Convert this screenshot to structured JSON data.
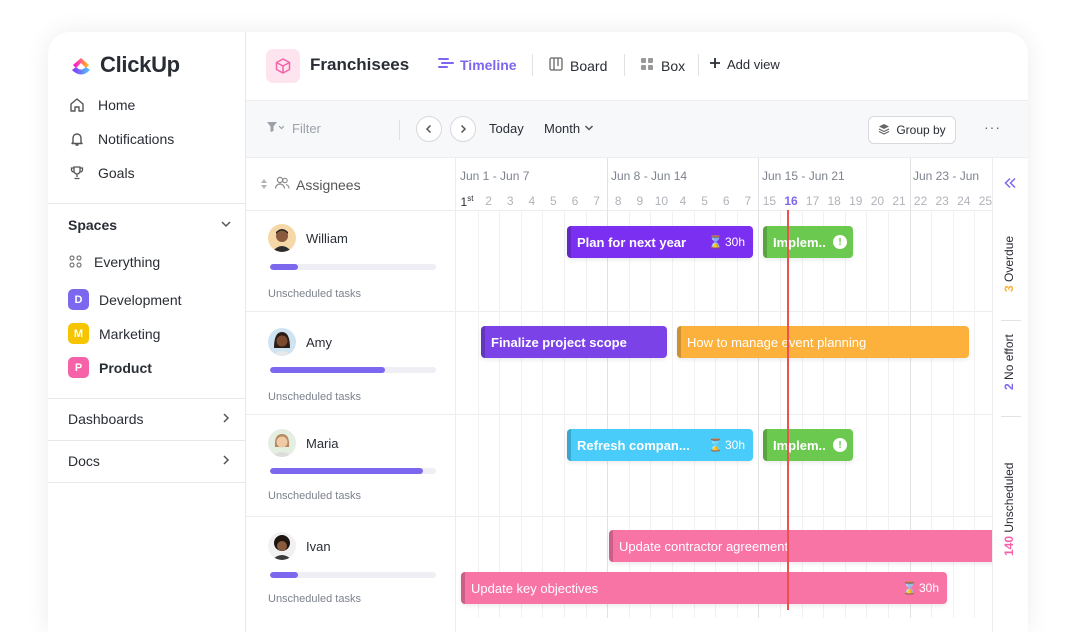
{
  "app": {
    "name": "ClickUp"
  },
  "sidebar": {
    "nav": [
      {
        "label": "Home",
        "icon": "home-icon"
      },
      {
        "label": "Notifications",
        "icon": "bell-icon"
      },
      {
        "label": "Goals",
        "icon": "trophy-icon"
      }
    ],
    "spaces_label": "Spaces",
    "everything_label": "Everything",
    "spaces": [
      {
        "letter": "D",
        "label": "Development",
        "color": "#7b68ee"
      },
      {
        "letter": "M",
        "label": "Marketing",
        "color": "#f7c400"
      },
      {
        "letter": "P",
        "label": "Product",
        "color": "#f562a8"
      }
    ],
    "dashboards_label": "Dashboards",
    "docs_label": "Docs"
  },
  "header": {
    "title": "Franchisees",
    "tabs": [
      {
        "label": "Timeline",
        "active": true
      },
      {
        "label": "Board",
        "active": false
      },
      {
        "label": "Box",
        "active": false
      }
    ],
    "add_view_label": "Add view"
  },
  "toolbar": {
    "filter_placeholder": "Filter",
    "today_label": "Today",
    "range_label": "Month",
    "group_by_label": "Group by",
    "more_label": "···"
  },
  "grid": {
    "assignees_label": "Assignees",
    "weeks": [
      "Jun 1 - Jun 7",
      "Jun 8 - Jun 14",
      "Jun 15 - Jun 21",
      "Jun 23 - Jun"
    ],
    "first_day": "1",
    "first_day_suffix": "st",
    "days": [
      "2",
      "3",
      "4",
      "5",
      "6",
      "7",
      "8",
      "9",
      "10",
      "4",
      "5",
      "6",
      "7",
      "15",
      "16",
      "17",
      "18",
      "19",
      "20",
      "21",
      "22",
      "23",
      "24",
      "25"
    ],
    "today": "16",
    "people": [
      {
        "name": "William",
        "progress": 0.17,
        "unscheduled_label": "Unscheduled tasks"
      },
      {
        "name": "Amy",
        "progress": 0.69,
        "unscheduled_label": "Unscheduled tasks"
      },
      {
        "name": "Maria",
        "progress": 0.92,
        "unscheduled_label": "Unscheduled tasks"
      },
      {
        "name": "Ivan",
        "progress": 0.17,
        "unscheduled_label": "Unscheduled tasks"
      }
    ],
    "tasks": [
      {
        "label": "Plan for next year",
        "estimate": "30h",
        "color": "#7b2ff0"
      },
      {
        "label": "Implem..",
        "color": "#6bc950",
        "warn": "!"
      },
      {
        "label": "Finalize project scope",
        "color": "#7b42e8"
      },
      {
        "label": "How to manage event planning",
        "color": "#fbb13c"
      },
      {
        "label": "Refresh compan...",
        "estimate": "30h",
        "color": "#49ccf9"
      },
      {
        "label": "Implem..",
        "color": "#6bc950",
        "warn": "!"
      },
      {
        "label": "Update contractor agreement",
        "color": "#f774a5"
      },
      {
        "label": "Update key objectives",
        "estimate": "30h",
        "color": "#f774a5"
      }
    ]
  },
  "strip": {
    "overdue": {
      "count": "3",
      "label": "Overdue",
      "color": "#fbb13c"
    },
    "no_effort": {
      "count": "2",
      "label": "No effort",
      "color": "#7b68ee"
    },
    "unscheduled": {
      "count": "140",
      "label": "Unscheduled",
      "color": "#f562a8"
    }
  }
}
